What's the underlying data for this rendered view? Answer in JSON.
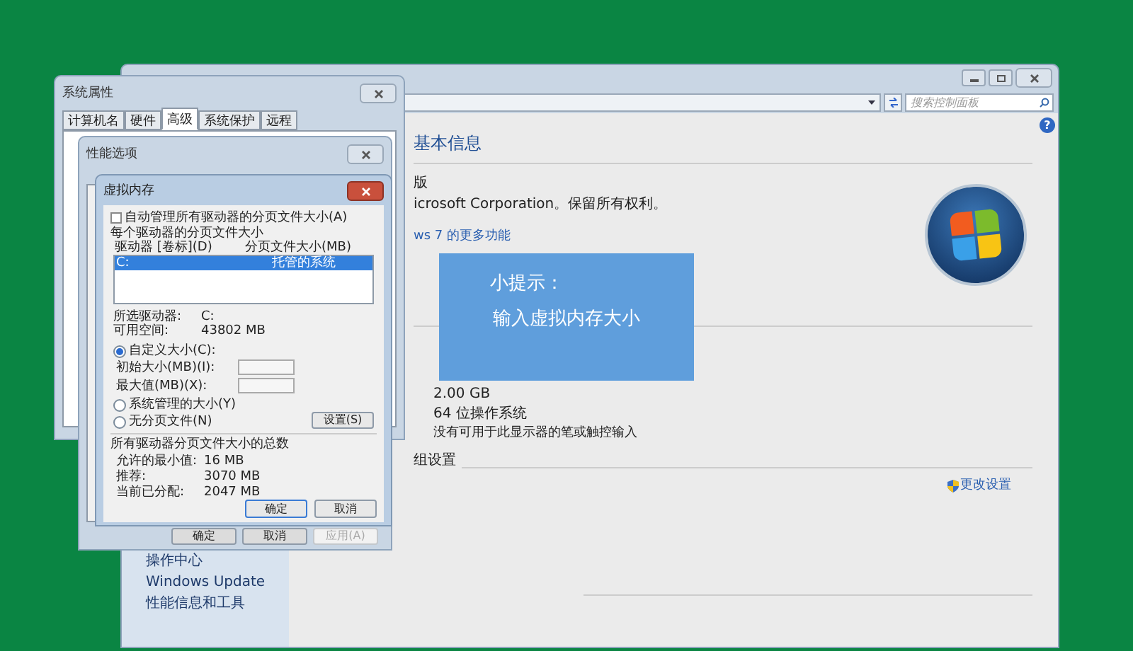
{
  "control_panel": {
    "search": {
      "placeholder": "搜索控制面板"
    },
    "heading": "基本信息",
    "edition": "版",
    "copyright": "icrosoft Corporation。保留所有权利。",
    "more_link": "ws 7 的更多功能",
    "memory": "2.00 GB",
    "system_type": "64 位操作系统",
    "pen_touch": "没有可用于此显示器的笔或触控输入",
    "section": "组设置",
    "change_link": "更改设置",
    "sidebar": [
      "操作中心",
      "Windows Update",
      "性能信息和工具"
    ],
    "help": "?"
  },
  "system_properties": {
    "title": "系统属性",
    "tabs": [
      {
        "label": "计算机名",
        "selected": false
      },
      {
        "label": "硬件",
        "selected": false
      },
      {
        "label": "高级",
        "selected": true
      },
      {
        "label": "系统保护",
        "selected": false
      },
      {
        "label": "远程",
        "selected": false
      }
    ]
  },
  "performance_options": {
    "title": "性能选项",
    "buttons": [
      {
        "label": "确定",
        "disabled": false
      },
      {
        "label": "取消",
        "disabled": false
      },
      {
        "label": "应用(A)",
        "disabled": true
      }
    ]
  },
  "virtual_memory": {
    "title": "虚拟内存",
    "auto_manage": {
      "label": "自动管理所有驱动器的分页文件大小(A)",
      "checked": false
    },
    "group_title": "每个驱动器的分页文件大小",
    "columns": [
      "驱动器 [卷标](D)",
      "分页文件大小(MB)"
    ],
    "drives": [
      {
        "drive": "C:",
        "paging": "托管的系统",
        "selected": true
      }
    ],
    "selected_drive_label": "所选驱动器:",
    "selected_drive": "C:",
    "free_space_label": "可用空间:",
    "free_space": "43802 MB",
    "options": [
      {
        "label": "自定义大小(C):",
        "selected": true
      },
      {
        "label": "系统管理的大小(Y)",
        "selected": false
      },
      {
        "label": "无分页文件(N)",
        "selected": false
      }
    ],
    "initial_size_label": "初始大小(MB)(I):",
    "max_size_label": "最大值(MB)(X):",
    "set_button": "设置(S)",
    "totals_title": "所有驱动器分页文件大小的总数",
    "totals": [
      {
        "label": "允许的最小值:",
        "value": "16 MB"
      },
      {
        "label": "推荐:",
        "value": "3070 MB"
      },
      {
        "label": "当前已分配:",
        "value": "2047 MB"
      }
    ],
    "buttons": [
      "确定",
      "取消"
    ]
  },
  "tip": {
    "title": "小提示：",
    "text": "输入虚拟内存大小"
  }
}
